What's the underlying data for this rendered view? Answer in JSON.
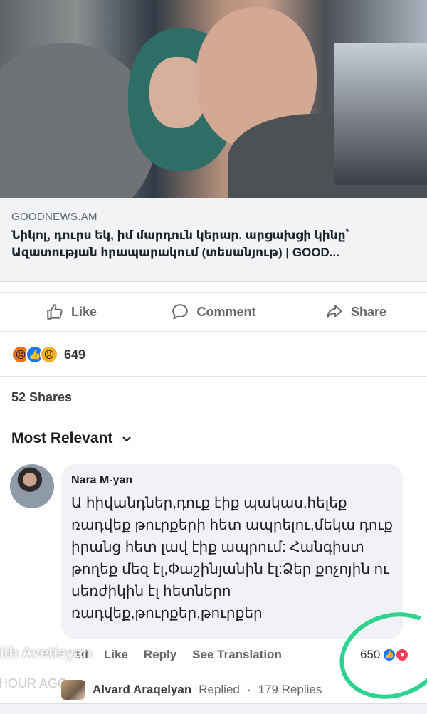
{
  "post_image": {
    "alt_semantic": "news-photo"
  },
  "link_preview": {
    "domain": "GOODNEWS.AM",
    "title": "Նիկոլ, դուրս եկ, իմ մարդուն կերար. արցախցի կինը՝ Ազատության հրապարակում (տեսանյութ) | GOOD..."
  },
  "actions": {
    "like": "Like",
    "comment": "Comment",
    "share": "Share"
  },
  "reactions": {
    "icons": [
      "angry-icon",
      "like-icon",
      "sad-icon"
    ],
    "count": "649"
  },
  "shares_label": "52 Shares",
  "sort_label": "Most Relevant",
  "comment": {
    "author": "Nara M-yan",
    "text": "Ա հիվանդներ,դուք էիք պակաս,հելեք ռադվեք թուրքերի հետ ապրելու,մեկա դուք իրանց հետ լավ էիք ապրում: Հանգիստ թողեք մեզ էլ,Փաշինյանին էլ:Ձեր քոչոյին ու սեռժիկին էլ հետներո ռադվեք,թուրքեր,թուրքեր",
    "time": "1d",
    "like_label": "Like",
    "reply_label": "Reply",
    "translate_label": "See Translation",
    "reaction_count": "650"
  },
  "overlay": {
    "name": "lith Avetisyan",
    "time": "HOUR AGO"
  },
  "replies": {
    "author": "Alvard Araqelyan",
    "action": "Replied",
    "separator": "·",
    "count_label": "179 Replies"
  },
  "colors": {
    "facebook_blue": "#1877f2",
    "annotation_green": "#2ed38f",
    "muted_text": "#65676b"
  }
}
